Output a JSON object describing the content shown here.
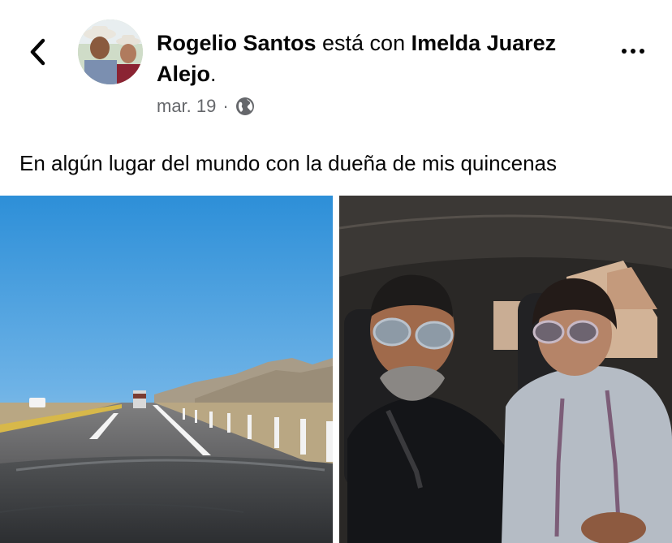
{
  "post": {
    "author_name": "Rogelio Santos",
    "connector": " está con ",
    "tagged_name": "Imelda Juarez Alejo",
    "end_punct": ".",
    "date": "mar. 19",
    "separator": "·",
    "audience_icon": "globe-icon",
    "caption": "En algún lugar del mundo con la dueña de mis quincenas"
  },
  "nav": {
    "back_icon": "chevron-left-icon",
    "more_icon": "more-horizontal-icon"
  },
  "photos": [
    {
      "name": "highway-photo"
    },
    {
      "name": "car-selfie-photo"
    }
  ],
  "colors": {
    "text": "#050505",
    "secondary_text": "#65676b",
    "background": "#ffffff"
  }
}
